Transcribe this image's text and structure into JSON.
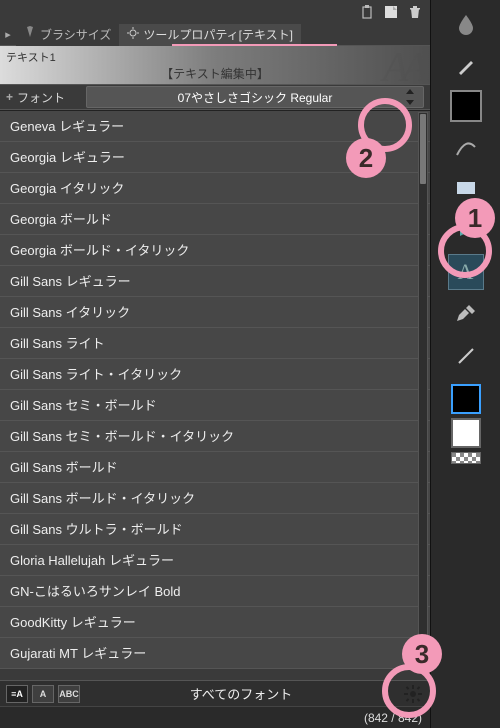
{
  "tabs": {
    "brush_size": "ブラシサイズ",
    "tool_prop": "ツールプロパティ[テキスト]"
  },
  "text_header": {
    "title": "テキスト1",
    "editing": "【テキスト編集中】"
  },
  "font_row": {
    "label": "フォント",
    "current": "07やさしさゴシック Regular"
  },
  "fonts": [
    "Geneva レギュラー",
    "Georgia レギュラー",
    "Georgia イタリック",
    "Georgia ボールド",
    "Georgia ボールド・イタリック",
    "Gill Sans レギュラー",
    "Gill Sans イタリック",
    "Gill Sans ライト",
    "Gill Sans ライト・イタリック",
    "Gill Sans セミ・ボールド",
    "Gill Sans セミ・ボールド・イタリック",
    "Gill Sans ボールド",
    "Gill Sans ボールド・イタリック",
    "Gill Sans ウルトラ・ボールド",
    "Gloria Hallelujah レギュラー",
    "GN-こはるいろサンレイ Bold",
    "GoodKitty レギュラー",
    "Gujarati MT レギュラー"
  ],
  "bottom": {
    "all_fonts": "すべてのフォント"
  },
  "status": {
    "count": "(842 / 842)"
  },
  "anno": {
    "n1": "1",
    "n2": "2",
    "n3": "3"
  }
}
